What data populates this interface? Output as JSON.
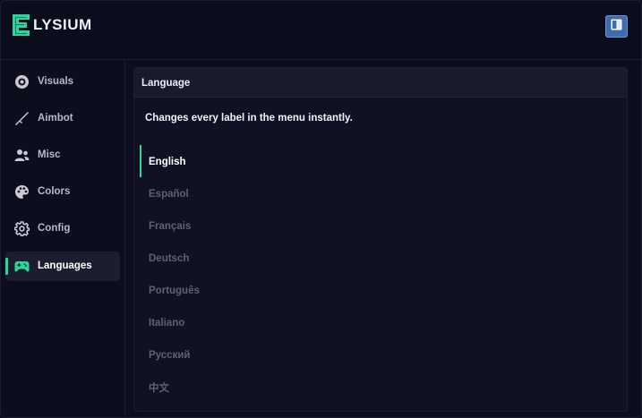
{
  "app": {
    "name": "LYSIUM",
    "accent_color": "#2ed59b"
  },
  "header": {
    "book_button_icon": "book-icon"
  },
  "sidebar": {
    "items": [
      {
        "label": "Visuals",
        "icon": "eye-icon",
        "active": false
      },
      {
        "label": "Aimbot",
        "icon": "rifle-icon",
        "active": false
      },
      {
        "label": "Misc",
        "icon": "users-icon",
        "active": false
      },
      {
        "label": "Colors",
        "icon": "palette-icon",
        "active": false
      },
      {
        "label": "Config",
        "icon": "gear-icon",
        "active": false
      },
      {
        "label": "Languages",
        "icon": "gamepad-icon",
        "active": true
      }
    ]
  },
  "panel": {
    "title": "Language",
    "description": "Changes every label in the menu instantly.",
    "languages": [
      {
        "label": "English",
        "selected": true
      },
      {
        "label": "Español",
        "selected": false
      },
      {
        "label": "Français",
        "selected": false
      },
      {
        "label": "Deutsch",
        "selected": false
      },
      {
        "label": "Português",
        "selected": false
      },
      {
        "label": "Italiano",
        "selected": false
      },
      {
        "label": "Русский",
        "selected": false
      },
      {
        "label": "中文",
        "selected": false
      }
    ]
  }
}
